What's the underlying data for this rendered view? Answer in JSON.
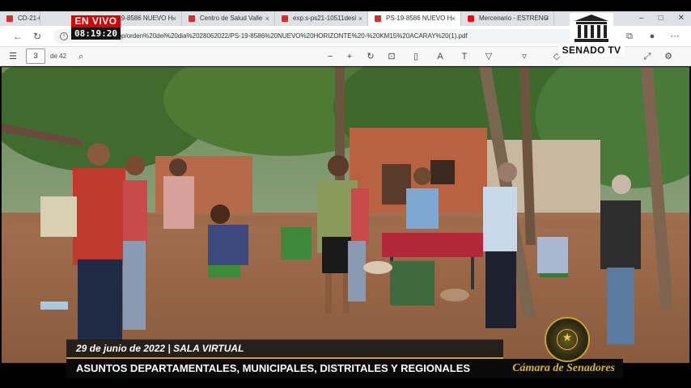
{
  "live": {
    "label": "EN VIVO",
    "time": "08:19:20"
  },
  "browser": {
    "tabs": [
      {
        "label": "CD-21-651",
        "icon": "pdf-icon"
      },
      {
        "label": "PS-19-8586 NUEVO H",
        "icon": "pdf-icon"
      },
      {
        "label": "Centro de Salud Valle",
        "icon": "pdf-icon"
      },
      {
        "label": "exp.s-ps21-10511desi",
        "icon": "pdf-icon"
      },
      {
        "label": "PS-19-8586 NUEVO H",
        "icon": "pdf-icon",
        "active": true
      },
      {
        "label": "Mercenario - ESTRENO",
        "icon": "youtube-icon"
      }
    ],
    "url": "sers/user/Desktop/orden%20del%20dia%2028062022/PS-19-8586%20NUEVO%20HORIZONTE%20-%20KM15%20ACARAY%20(1).pdf"
  },
  "pdf_toolbar": {
    "page": "3",
    "page_of": "de 42"
  },
  "logo": {
    "text": "SENADO TV"
  },
  "lower_third": {
    "date": "29 de junio de 2022  |  SALA  VIRTUAL",
    "title": "ASUNTOS DEPARTAMENTALES, MUNICIPALES, DISTRITALES Y REGIONALES",
    "brand": "Cámara de Senadores"
  },
  "colors": {
    "live_red": "#d50000",
    "gold": "#c9a227",
    "chrome": "#dee1e6"
  }
}
